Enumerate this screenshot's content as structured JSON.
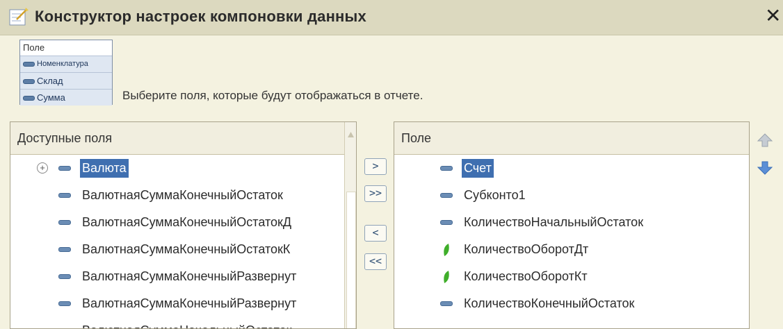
{
  "window": {
    "title": "Конструктор настроек компоновки данных",
    "close_icon": "close-icon",
    "title_icon": "wizard-icon"
  },
  "hint": {
    "legend_header": "Поле",
    "legend_items": [
      "Номенклатура",
      "Склад",
      "Сумма"
    ],
    "text": "Выберите поля, которые будут отображаться в отчете."
  },
  "available": {
    "header": "Доступные поля",
    "items": [
      {
        "label": "Валюта",
        "selected": true,
        "expandable": true
      },
      {
        "label": "ВалютнаяСуммаКонечныйОстаток"
      },
      {
        "label": "ВалютнаяСуммаКонечныйОстатокД"
      },
      {
        "label": "ВалютнаяСуммаКонечныйОстатокК"
      },
      {
        "label": "ВалютнаяСуммаКонечныйРазвернут"
      },
      {
        "label": "ВалютнаяСуммаКонечныйРазвернут"
      },
      {
        "label": "ВалютнаяСуммаНачальныйОстаток"
      }
    ]
  },
  "move_buttons": {
    "add": ">",
    "add_all": ">>",
    "remove": "<",
    "remove_all": "<<"
  },
  "selected": {
    "header": "Поле",
    "items": [
      {
        "label": "Счет",
        "selected": true,
        "icon": "field-icon"
      },
      {
        "label": "Субконто1",
        "icon": "field-icon"
      },
      {
        "label": "КоличествоНачальныйОстаток",
        "icon": "field-icon"
      },
      {
        "label": "КоличествоОборотДт",
        "icon": "resource-icon"
      },
      {
        "label": "КоличествоОборотКт",
        "icon": "resource-icon"
      },
      {
        "label": "КоличествоКонечныйОстаток",
        "icon": "field-icon"
      }
    ]
  },
  "colors": {
    "selection": "#3f6fb0",
    "background": "#f4f2e0",
    "header": "#f1eedf",
    "resource_green": "#3fae2a"
  }
}
